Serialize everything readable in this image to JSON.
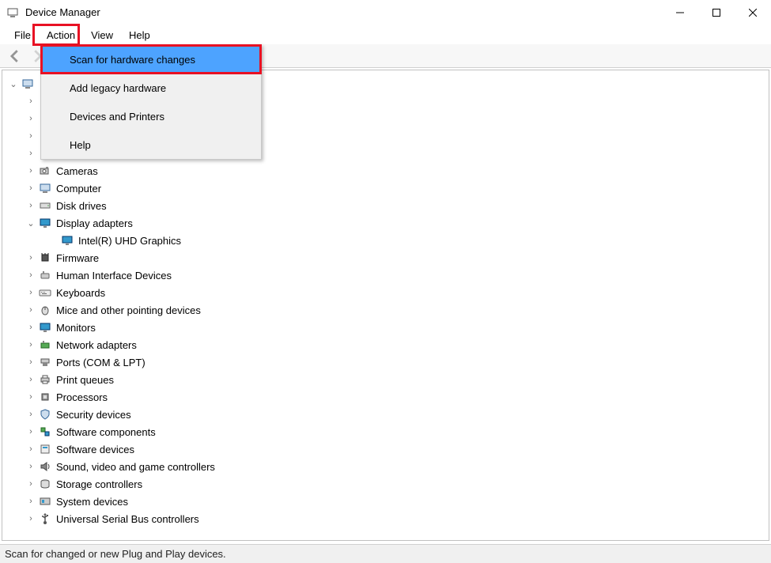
{
  "window": {
    "title": "Device Manager"
  },
  "menubar": {
    "file": "File",
    "action": "Action",
    "view": "View",
    "help": "Help"
  },
  "dropdown": {
    "scan": "Scan for hardware changes",
    "legacy": "Add legacy hardware",
    "printers": "Devices and Printers",
    "help": "Help"
  },
  "tree": {
    "root": "",
    "display_adapters": "Display adapters",
    "display_child": "Intel(R) UHD Graphics",
    "items": {
      "cameras": "Cameras",
      "computer": "Computer",
      "disk": "Disk drives",
      "firmware": "Firmware",
      "hid": "Human Interface Devices",
      "keyboards": "Keyboards",
      "mice": "Mice and other pointing devices",
      "monitors": "Monitors",
      "network": "Network adapters",
      "ports": "Ports (COM & LPT)",
      "printq": "Print queues",
      "processors": "Processors",
      "security": "Security devices",
      "swcomp": "Software components",
      "swdev": "Software devices",
      "sound": "Sound, video and game controllers",
      "storage": "Storage controllers",
      "system": "System devices",
      "usb": "Universal Serial Bus controllers"
    }
  },
  "statusbar": {
    "text": "Scan for changed or new Plug and Play devices."
  }
}
